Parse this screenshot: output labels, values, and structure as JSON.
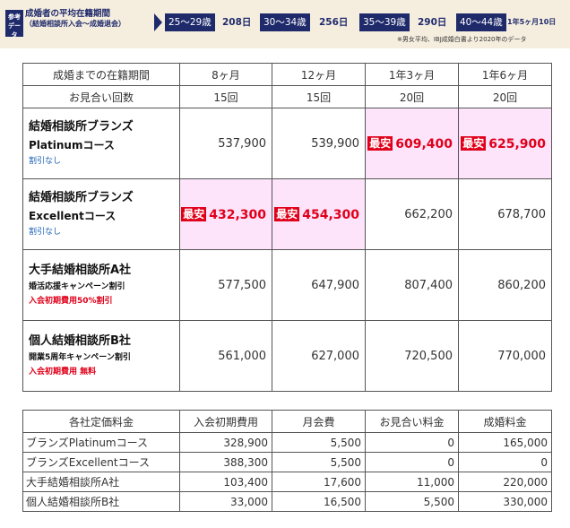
{
  "banner": {
    "badge": "参考データ",
    "title": "成婚者の平均在籍期間",
    "subtitle": "（結婚相談所入会〜成婚退会）",
    "ages": [
      {
        "range": "25〜29歳",
        "value": "208日"
      },
      {
        "range": "30〜34歳",
        "value": "256日"
      },
      {
        "range": "35〜39歳",
        "value": "290日"
      },
      {
        "range": "40〜44歳",
        "value": "1年5ヶ月10日"
      }
    ],
    "note": "※男女平均、IBJ成婚白書より2020年のデータ",
    "colors": {
      "navy": "#1f2a6b",
      "bg": "#f5eedf"
    }
  },
  "comparison": {
    "header_period_label": "成婚までの在籍期間",
    "header_meetings_label": "お見合い回数",
    "periods": [
      "8ヶ月",
      "12ヶ月",
      "1年3ヶ月",
      "1年6ヶ月"
    ],
    "meetings": [
      "15回",
      "15回",
      "20回",
      "20回"
    ],
    "best_tag": "最安",
    "rows": [
      {
        "name1": "結婚相談所ブランズ",
        "name2": "Platinumコース",
        "note1": "割引なし",
        "note2": "",
        "values": [
          "537,900",
          "539,900",
          "609,400",
          "625,900"
        ],
        "best": [
          false,
          false,
          true,
          true
        ]
      },
      {
        "name1": "結婚相談所ブランズ",
        "name2": "Excellentコース",
        "note1": "割引なし",
        "note2": "",
        "values": [
          "432,300",
          "454,300",
          "662,200",
          "678,700"
        ],
        "best": [
          true,
          true,
          false,
          false
        ]
      },
      {
        "name1": "大手結婚相談所A社",
        "name2": "婚活応援キャンペーン割引",
        "note1": "",
        "note2": "入会初期費用50%割引",
        "values": [
          "577,500",
          "647,900",
          "807,400",
          "860,200"
        ],
        "best": [
          false,
          false,
          false,
          false
        ]
      },
      {
        "name1": "個人結婚相談所B社",
        "name2": "開業5周年キャンペーン割引",
        "note1": "",
        "note2": "入会初期費用 無料",
        "values": [
          "561,000",
          "627,000",
          "720,500",
          "770,000"
        ],
        "best": [
          false,
          false,
          false,
          false
        ]
      }
    ]
  },
  "fees": {
    "headers": [
      "各社定価料金",
      "入会初期費用",
      "月会費",
      "お見合い料金",
      "成婚料金"
    ],
    "rows": [
      [
        "ブランズPlatinumコース",
        "328,900",
        "5,500",
        "0",
        "165,000"
      ],
      [
        "ブランズExcellentコース",
        "388,300",
        "5,500",
        "0",
        "0"
      ],
      [
        "大手結婚相談所A社",
        "103,400",
        "17,600",
        "11,000",
        "220,000"
      ],
      [
        "個人結婚相談所B社",
        "33,000",
        "16,500",
        "5,500",
        "330,000"
      ]
    ]
  }
}
